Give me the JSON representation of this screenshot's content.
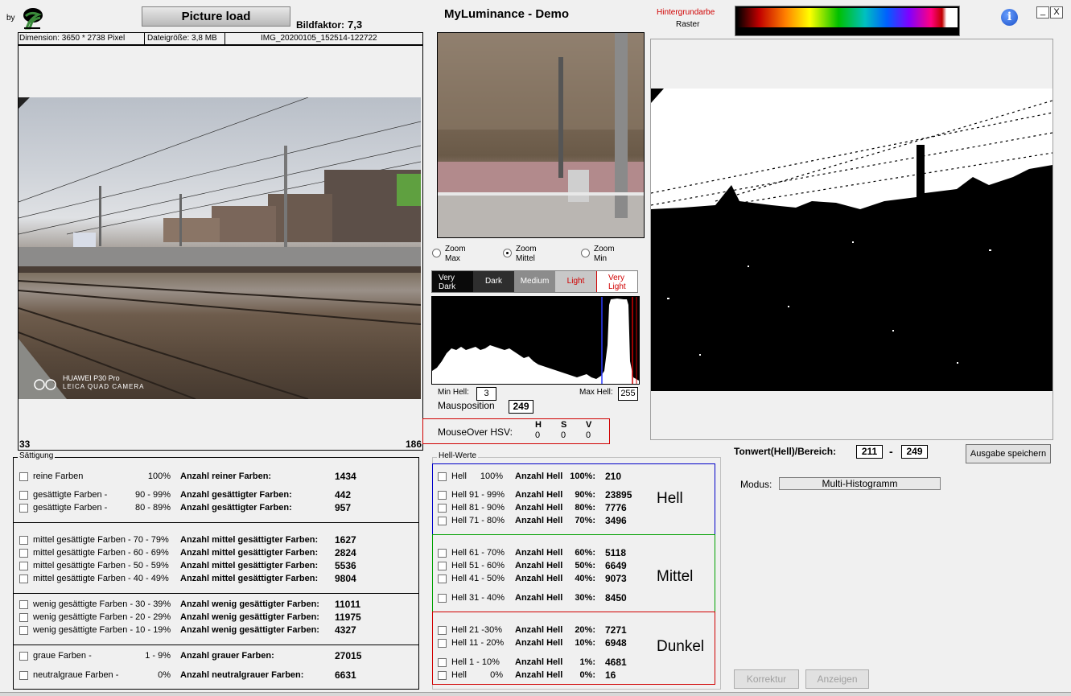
{
  "header": {
    "by_label": "by",
    "picture_load": "Picture load",
    "bildfaktor_label": "Bildfaktor:",
    "bildfaktor_value": "7,3",
    "app_title": "MyLuminance - Demo",
    "hintergrund_label": "Hintergrundarbe",
    "raster_label": "Raster",
    "minimize": "_",
    "close": "X"
  },
  "info_bar": {
    "dimension": "Dimension: 3650 * 2738 Pixel",
    "filesize": "Dateigröße: 3,8 MB",
    "filename": "IMG_20200105_152514-122722"
  },
  "left_image": {
    "corner_left": "33",
    "corner_right": "186",
    "watermark_1": "HUAWEI P30 Pro",
    "watermark_2": "LEICA QUAD CAMERA"
  },
  "zoom": {
    "options": [
      {
        "label": "Zoom\nMax",
        "l1": "Zoom",
        "l2": "Max",
        "selected": false
      },
      {
        "label": "Zoom\nMittel",
        "l1": "Zoom",
        "l2": "Mittel",
        "selected": true
      },
      {
        "label": "Zoom\nMin",
        "l1": "Zoom",
        "l2": "Min",
        "selected": false
      }
    ]
  },
  "tone_tabs": {
    "very_dark_1": "Very",
    "very_dark_2": "Dark",
    "dark": "Dark",
    "medium": "Medium",
    "light": "Light",
    "very_light_1": "Very",
    "very_light_2": "Light"
  },
  "histogram": {
    "min_label": "Min Hell:",
    "min_value": "3",
    "max_label": "Max Hell:",
    "max_value": "255",
    "maus_label": "Mausposition",
    "maus_value": "249"
  },
  "hsv": {
    "label": "MouseOver HSV:",
    "h": "H",
    "s": "S",
    "v": "V",
    "h_val": "0",
    "s_val": "0",
    "v_val": "0"
  },
  "saettigung": {
    "title": "Sättigung",
    "rows": [
      {
        "label": "reine Farben",
        "range": "100%",
        "desc": "Anzahl reiner Farben:",
        "value": "1434"
      },
      {
        "label": "gesättigte Farben  -",
        "range": "90 - 99%",
        "desc": "Anzahl gesättigter Farben:",
        "value": "442"
      },
      {
        "label": "gesättigte Farben  -",
        "range": "80 - 89%",
        "desc": "Anzahl gesättigter Farben:",
        "value": "957"
      },
      {
        "label": "mittel gesättigte Farben  - 70 - 79%",
        "range": "",
        "desc": "Anzahl mittel gesättigter Farben:",
        "value": "1627"
      },
      {
        "label": "mittel gesättigte Farben  - 60 - 69%",
        "range": "",
        "desc": "Anzahl mittel gesättigter Farben:",
        "value": "2824"
      },
      {
        "label": "mittel gesättigte Farben  - 50 - 59%",
        "range": "",
        "desc": "Anzahl mittel gesättigter Farben:",
        "value": "5536"
      },
      {
        "label": "mittel gesättigte Farben  - 40 - 49%",
        "range": "",
        "desc": "Anzahl mittel gesättigter Farben:",
        "value": "9804"
      },
      {
        "label": "wenig gesättigte Farben - 30 - 39%",
        "range": "",
        "desc": "Anzahl wenig gesättigter Farben:",
        "value": "11011"
      },
      {
        "label": "wenig gesättigte Farben - 20 - 29%",
        "range": "",
        "desc": "Anzahl wenig gesättigter Farben:",
        "value": "11975"
      },
      {
        "label": "wenig gesättigte Farben - 10 - 19%",
        "range": "",
        "desc": "Anzahl wenig gesättigter Farben:",
        "value": "4327"
      },
      {
        "label": "graue Farben -",
        "range": "1 -  9%",
        "desc": "Anzahl grauer Farben:",
        "value": "27015"
      },
      {
        "label": "neutralgraue Farben -",
        "range": "0%",
        "desc": "Anzahl neutralgrauer Farben:",
        "value": "6631"
      }
    ]
  },
  "hell": {
    "title": "Hell-Werte",
    "group_hell": "Hell",
    "group_mittel": "Mittel",
    "group_dunkel": "Dunkel",
    "rows": [
      {
        "label": "Hell",
        "range": "100%",
        "desc": "Anzahl Hell",
        "pct": "100%:",
        "value": "210"
      },
      {
        "label": "Hell 91 - 99%",
        "range": "",
        "desc": "Anzahl Hell",
        "pct": "90%:",
        "value": "23895"
      },
      {
        "label": "Hell 81 - 90%",
        "range": "",
        "desc": "Anzahl Hell",
        "pct": "80%:",
        "value": "7776"
      },
      {
        "label": "Hell 71 - 80%",
        "range": "",
        "desc": "Anzahl Hell",
        "pct": "70%:",
        "value": "3496"
      },
      {
        "label": "Hell 61 - 70%",
        "range": "",
        "desc": "Anzahl Hell",
        "pct": "60%:",
        "value": "5118"
      },
      {
        "label": "Hell 51 - 60%",
        "range": "",
        "desc": "Anzahl Hell",
        "pct": "50%:",
        "value": "6649"
      },
      {
        "label": "Hell 41 - 50%",
        "range": "",
        "desc": "Anzahl Hell",
        "pct": "40%:",
        "value": "9073"
      },
      {
        "label": "Hell 31 - 40%",
        "range": "",
        "desc": "Anzahl Hell",
        "pct": "30%:",
        "value": "8450"
      },
      {
        "label": "Hell 21 -30%",
        "range": "",
        "desc": "Anzahl Hell",
        "pct": "20%:",
        "value": "7271"
      },
      {
        "label": "Hell 11 - 20%",
        "range": "",
        "desc": "Anzahl Hell",
        "pct": "10%:",
        "value": "6948"
      },
      {
        "label": "Hell  1 - 10%",
        "range": "",
        "desc": "Anzahl Hell",
        "pct": "1%:",
        "value": "4681"
      },
      {
        "label": "Hell",
        "range": "0%",
        "desc": "Anzahl Hell",
        "pct": "0%:",
        "value": "16"
      }
    ]
  },
  "right_panel": {
    "tonwert_label": "Tonwert(Hell)/Bereich:",
    "tonwert_from": "211",
    "tonwert_dash": "-",
    "tonwert_to": "249",
    "ausgabe_button": "Ausgabe speichern",
    "modus_label": "Modus:",
    "modus_value": "Multi-Histogramm",
    "korrektur_button": "Korrektur",
    "anzeigen_button": "Anzeigen"
  },
  "colors": {
    "hell_border": "#0000c8",
    "mittel_border": "#00a000",
    "dunkel_border": "#d00000",
    "hsv_border": "#d00000"
  }
}
